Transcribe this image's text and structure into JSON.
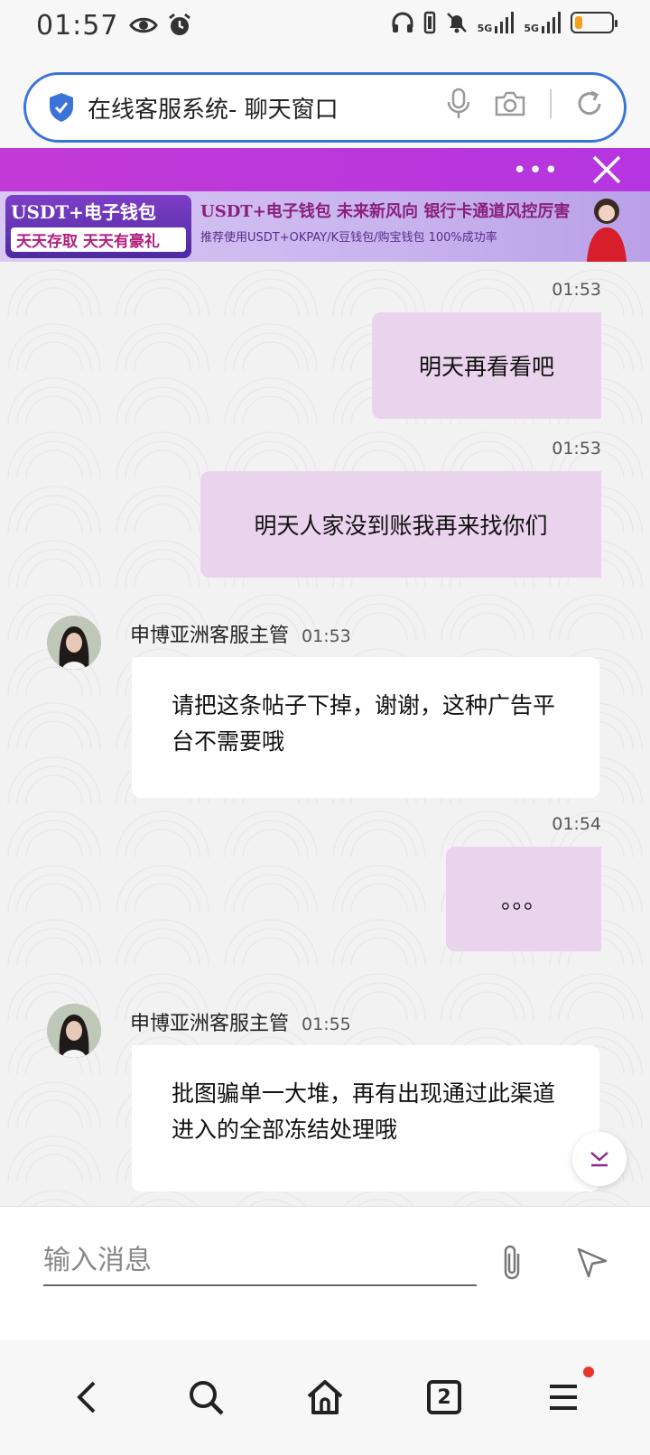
{
  "status_bar": {
    "time": "01:57",
    "net1": "5G",
    "net2": "5G",
    "battery_level": 0.2
  },
  "address_bar": {
    "title": "在线客服系统- 聊天窗口"
  },
  "ad": {
    "more": "•••",
    "left_line1": "USDT+电子钱包",
    "left_line2": "天天存取 天天有豪礼",
    "mid_line1": "USDT+电子钱包  未来新风向  银行卡通道风控厉害",
    "mid_line2": "推荐使用USDT+OKPAY/K豆钱包/购宝钱包   100%成功率"
  },
  "chat": {
    "messages": [
      {
        "time": "01:53",
        "text": "明天再看看吧"
      },
      {
        "time": "01:53",
        "text": "明天人家没到账我再来找你们"
      },
      {
        "sender": "申博亚洲客服主管",
        "time": "01:53",
        "text": "请把这条帖子下掉，谢谢，这种广告平台不需要哦"
      },
      {
        "time": "01:54",
        "text": "。。。"
      },
      {
        "sender": "申博亚洲客服主管",
        "time": "01:55",
        "text": "批图骗单一大堆，再有出现通过此渠道进入的全部冻结处理哦"
      }
    ]
  },
  "input": {
    "placeholder": "输入消息"
  },
  "nav": {
    "tab_count": "2"
  },
  "colors": {
    "accent": "#3b74d9",
    "outgoing_bubble": "#ead3ec",
    "ad_bar": "#c23ad6"
  }
}
